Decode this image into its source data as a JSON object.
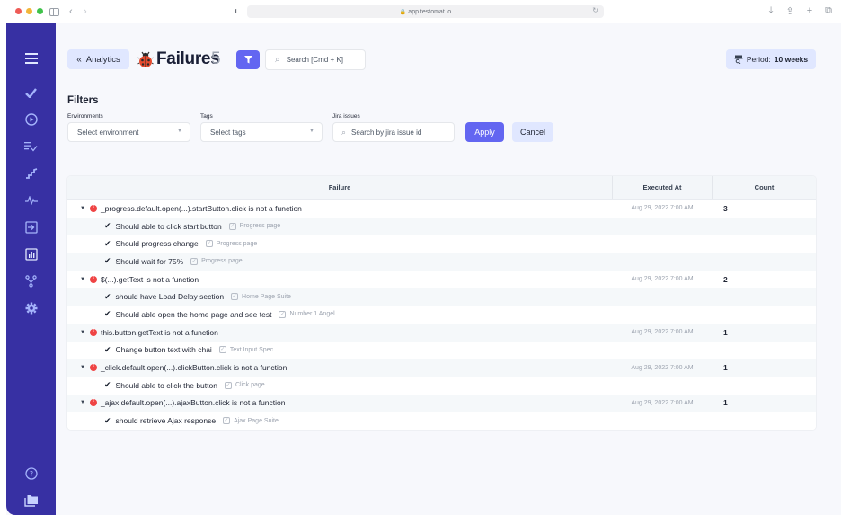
{
  "browser": {
    "url": "app.testomat.io"
  },
  "sidebar": {
    "items": [
      {
        "icon": "menu-icon"
      },
      {
        "icon": "checkmark-icon"
      },
      {
        "icon": "play-circle-icon"
      },
      {
        "icon": "list-check-icon"
      },
      {
        "icon": "steps-icon"
      },
      {
        "icon": "pulse-icon"
      },
      {
        "icon": "import-icon"
      },
      {
        "icon": "bar-chart-icon"
      },
      {
        "icon": "branch-icon"
      },
      {
        "icon": "gear-icon"
      }
    ],
    "bottom": [
      {
        "icon": "help-icon"
      },
      {
        "icon": "folders-icon"
      }
    ]
  },
  "header": {
    "back_label": "Analytics",
    "title": "Failures",
    "count": "5",
    "search_placeholder": "Search [Cmd + K]",
    "period_prefix": "Period:",
    "period_value": "10 weeks"
  },
  "filters": {
    "title": "Filters",
    "environments_label": "Environments",
    "environments_placeholder": "Select environment",
    "tags_label": "Tags",
    "tags_placeholder": "Select tags",
    "jira_label": "Jira issues",
    "jira_placeholder": "Search by jira issue id",
    "apply_label": "Apply",
    "cancel_label": "Cancel"
  },
  "table": {
    "columns": [
      "Failure",
      "Executed At",
      "Count"
    ],
    "groups": [
      {
        "failure": "_progress.default.open(...).startButton.click is not a function",
        "executed_at": "Aug 29, 2022 7:00 AM",
        "count": "3",
        "tests": [
          {
            "name": "Should able to click start button",
            "suite": "Progress page"
          },
          {
            "name": "Should progress change",
            "suite": "Progress page"
          },
          {
            "name": "Should wait for 75%",
            "suite": "Progress page"
          }
        ]
      },
      {
        "failure": "$(...).getText is not a function",
        "executed_at": "Aug 29, 2022 7:00 AM",
        "count": "2",
        "tests": [
          {
            "name": "should have Load Delay section",
            "suite": "Home Page Suite"
          },
          {
            "name": "Should able open the home page and see test",
            "suite": "Number 1 Angel"
          }
        ]
      },
      {
        "failure": "this.button.getText is not a function",
        "executed_at": "Aug 29, 2022 7:00 AM",
        "count": "1",
        "tests": [
          {
            "name": "Change button text with chai",
            "suite": "Text Input Spec"
          }
        ]
      },
      {
        "failure": "_click.default.open(...).clickButton.click is not a function",
        "executed_at": "Aug 29, 2022 7:00 AM",
        "count": "1",
        "tests": [
          {
            "name": "Should able to click the button",
            "suite": "Click page"
          }
        ]
      },
      {
        "failure": "_ajax.default.open(...).ajaxButton.click is not a function",
        "executed_at": "Aug 29, 2022 7:00 AM",
        "count": "1",
        "tests": [
          {
            "name": "should retrieve Ajax response",
            "suite": "Ajax Page Suite"
          }
        ]
      }
    ]
  },
  "colors": {
    "sidebar": "#3730a3",
    "accent": "#6366f1",
    "soft_accent": "#e0e7ff",
    "error": "#ef4444"
  }
}
